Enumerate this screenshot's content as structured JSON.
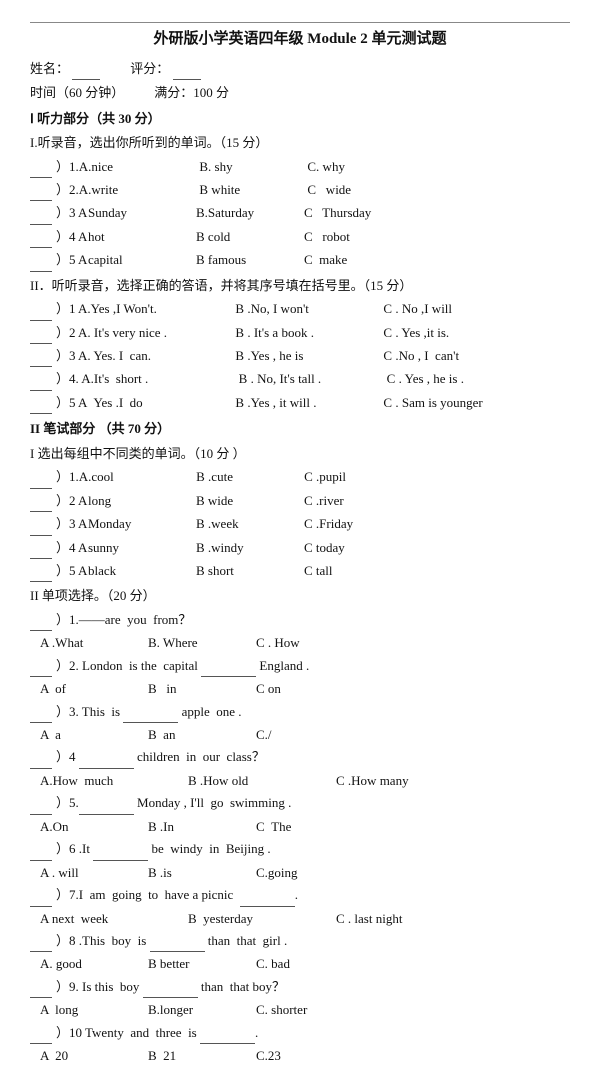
{
  "title": "外研版小学英语四年级 Module 2 单元测试题",
  "info": {
    "name_label": "姓名：",
    "name_blank": "________",
    "score_label": "评分：",
    "score_blank": "________",
    "time_label": "时间（60 分钟）",
    "full_score": "满分：100 分"
  },
  "part1": {
    "header": "Ⅰ 听力部分（共 30 分）",
    "section1": {
      "header": "I.听录音，选出你所听到的单词。（15 分）",
      "items": [
        {
          "num": "）1.A.",
          "a": "nice",
          "b": "B. shy",
          "c": "C. why"
        },
        {
          "num": "）2.A.",
          "a": "write",
          "b": "B white",
          "c": "C   wide"
        },
        {
          "num": "）3 A",
          "a": "Sunday",
          "b": "B.Saturday",
          "c": "C   Thursday"
        },
        {
          "num": "）4 A",
          "a": "hot",
          "b": "B cold",
          "c": "C   robot"
        },
        {
          "num": "）5 A",
          "a": "capital",
          "b": "B famous",
          "c": "C  make"
        }
      ]
    },
    "section2": {
      "header": "II．听听录音，选择正确的答语，并将其序号填在括号里。（15 分）",
      "items": [
        {
          "num": "）1 A",
          "a": ".Yes ,I Won't.",
          "b": "B .No, I won't",
          "c": "C . No ,I will"
        },
        {
          "num": "）2 A",
          "a": ". It's very nice .",
          "b": "B . It's a book .",
          "c": "C . Yes ,it is."
        },
        {
          "num": "）3 A",
          "a": ". Yes. I  can.",
          "b": "B .Yes , he is",
          "c": "C .No , I  can't"
        },
        {
          "num": "）4. A",
          "a": ".It's  short .",
          "b": "B . No, It's tall .",
          "c": "C . Yes , he is ."
        },
        {
          "num": "）5 A",
          "a": "  Yes .I  do",
          "b": "B .Yes , it will .",
          "c": "C . Sam is younger"
        }
      ]
    }
  },
  "part2": {
    "header": "II  笔试部分 （共 70 分）",
    "section1": {
      "header": "I 选出每组中不同类的单词。（10 分 ）",
      "items": [
        {
          "num": "）1.A",
          "a": ".cool",
          "b": "B .cute",
          "c": "C .pupil"
        },
        {
          "num": "）2 A",
          "a": "long",
          "b": "B wide",
          "c": "C .river"
        },
        {
          "num": "）3 A",
          "a": "Monday",
          "b": "B .week",
          "c": "C .Friday"
        },
        {
          "num": "）4 A",
          "a": "sunny",
          "b": "B .windy",
          "c": "C today"
        },
        {
          "num": "）5 A",
          "a": "black",
          "b": "B short",
          "c": "C tall"
        }
      ]
    },
    "section2": {
      "header": "II  单项选择。（20 分）",
      "items": [
        {
          "num": "）1.",
          "q": "——are  you  from？",
          "choices": [
            "A .What",
            "B. Where",
            "C . How"
          ]
        },
        {
          "num": "）2.",
          "q": "London  is the  capital ______ England .",
          "choices": [
            "A  of",
            "B   in",
            "C on"
          ]
        },
        {
          "num": "）3.",
          "q": "This  is _______ apple  one .",
          "choices": [
            "A  a",
            "B  an",
            "C./"
          ]
        },
        {
          "num": "）4",
          "q": "_______ children  in  our  class？",
          "choices": [
            "A.How  much",
            "B .How old",
            "C .How many"
          ]
        },
        {
          "num": "）5.",
          "q": "5._______ Monday , I'll  go  swimming .",
          "choices": [
            "A.On",
            "B .In",
            "C  The"
          ]
        },
        {
          "num": "）6 .It",
          "q": "__________ be  windy  in  Beijing .",
          "choices": [
            "A . will",
            "B .is",
            "C.going"
          ]
        },
        {
          "num": "）7.I  am  going  to  have a picnic  __________.",
          "q": "",
          "choices": [
            "A next  week",
            "B  yesterday",
            "C . last night"
          ]
        },
        {
          "num": "）8 .This  boy  is ________ than  that  girl .",
          "q": "",
          "choices": [
            "A. good",
            "B better",
            "C. bad"
          ]
        },
        {
          "num": "）9. Is this  boy ________ than  that boy？",
          "q": "",
          "choices": [
            "A  long",
            "B.longer",
            "C. shorter"
          ]
        },
        {
          "num": "）10 Twenty  and  three  is __________.",
          "q": "",
          "choices": [
            "A  20",
            "B  21",
            "C.23"
          ]
        }
      ]
    }
  }
}
